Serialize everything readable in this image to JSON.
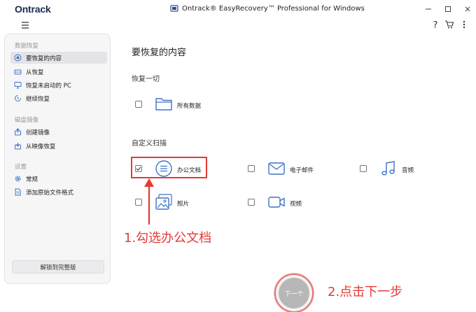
{
  "window": {
    "logo": "Ontrack",
    "title": "Ontrack® EasyRecovery™ Professional for Windows"
  },
  "sidebar": {
    "sections": [
      {
        "label": "数据恢复",
        "items": [
          {
            "label": "要恢复的内容",
            "icon": "target-icon",
            "active": true
          },
          {
            "label": "从恢复",
            "icon": "drive-icon"
          },
          {
            "label": "恢复未启动的 PC",
            "icon": "monitor-icon"
          },
          {
            "label": "继续恢复",
            "icon": "resume-icon"
          }
        ]
      },
      {
        "label": "磁盘镜像",
        "items": [
          {
            "label": "创建镜像",
            "icon": "create-image-icon"
          },
          {
            "label": "从映像恢复",
            "icon": "restore-image-icon"
          }
        ]
      },
      {
        "label": "设置",
        "items": [
          {
            "label": "常规",
            "icon": "gear-icon"
          },
          {
            "label": "添加原始文件格式",
            "icon": "file-format-icon"
          }
        ]
      }
    ],
    "unlock_label": "解锁到完整版"
  },
  "main": {
    "title": "要恢复的内容",
    "recover_all": {
      "title": "恢复一切",
      "item": {
        "label": "所有数据",
        "checked": false,
        "icon": "folder-icon"
      }
    },
    "custom_scan": {
      "title": "自定义扫描",
      "items": [
        {
          "label": "办公文档",
          "checked": true,
          "icon": "document-icon"
        },
        {
          "label": "电子邮件",
          "checked": false,
          "icon": "email-icon"
        },
        {
          "label": "音频",
          "checked": false,
          "icon": "music-icon"
        },
        {
          "label": "照片",
          "checked": false,
          "icon": "photo-icon"
        },
        {
          "label": "视频",
          "checked": false,
          "icon": "video-icon"
        }
      ]
    },
    "next_label": "下一个"
  },
  "annotations": {
    "step1": "1.勾选办公文档",
    "step2": "2.点击下一步"
  },
  "colors": {
    "accent_blue": "#3d73c7",
    "annotation_red": "#e53935",
    "sidebar_bg": "#f6f6f7",
    "next_button": "#b7b7b7"
  }
}
